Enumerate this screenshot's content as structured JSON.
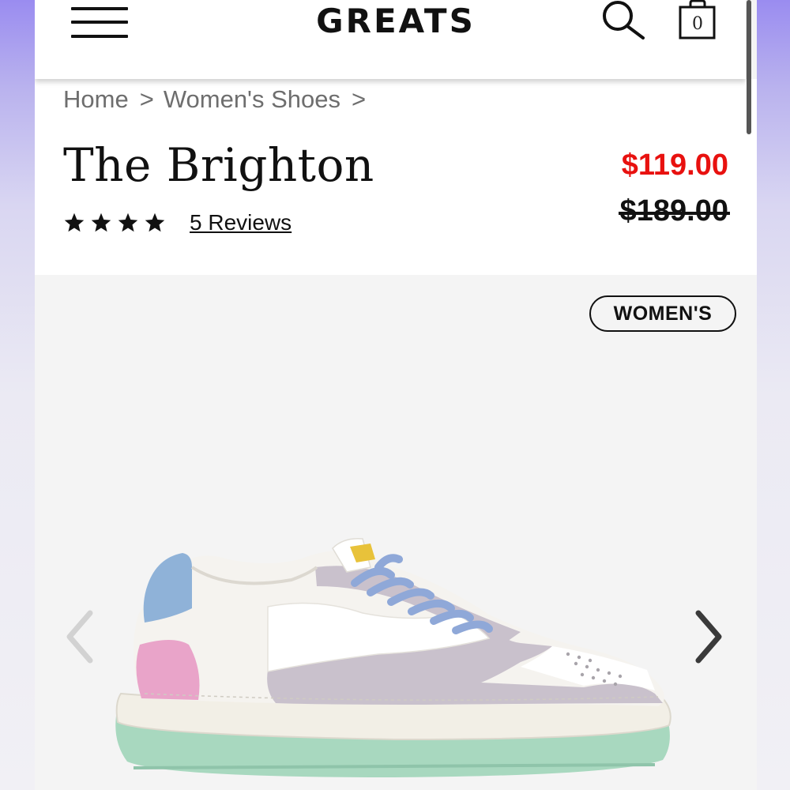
{
  "header": {
    "logo": "GREATS",
    "cart_count": "0"
  },
  "breadcrumb": [
    {
      "label": "Home"
    },
    {
      "label": "Women's Shoes"
    }
  ],
  "breadcrumb_separator": ">",
  "product": {
    "title": "The Brighton",
    "rating_stars": 4,
    "reviews_label": "5 Reviews",
    "sale_price": "$119.00",
    "original_price": "$189.00",
    "sale_color": "#e8110f"
  },
  "gallery": {
    "badge": "WOMEN'S",
    "image": "sneaker-photo",
    "colors": {
      "heel_tab": "#8fb2d8",
      "heel_counter": "#e9a4c9",
      "overlay": "#c9c1cc",
      "laces": "#8fa8d8",
      "outsole": "#a8d8bf",
      "tongue_label": "#e8c23a"
    }
  },
  "icons": {
    "menu": "hamburger-icon",
    "search": "search-icon",
    "cart": "shopping-bag-icon",
    "star": "star-icon",
    "prev": "chevron-left-icon",
    "next": "chevron-right-icon"
  }
}
